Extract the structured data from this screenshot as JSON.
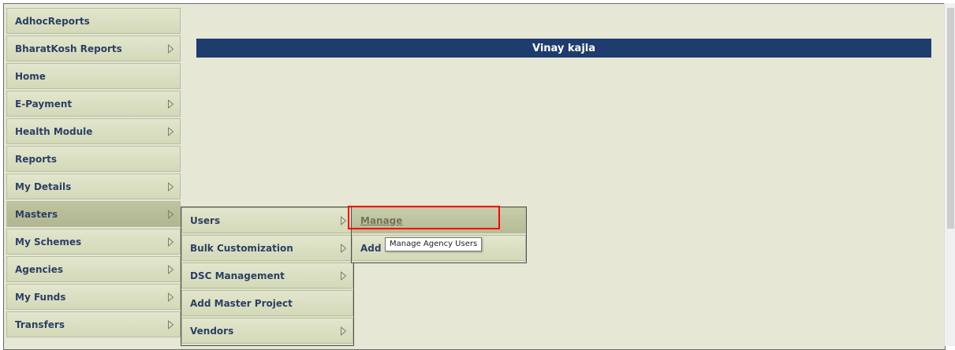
{
  "banner": {
    "user_name": "Vinay kajla"
  },
  "main_menu": [
    {
      "label": "AdhocReports",
      "has_arrow": false
    },
    {
      "label": "BharatKosh Reports",
      "has_arrow": true
    },
    {
      "label": "Home",
      "has_arrow": false
    },
    {
      "label": "E-Payment",
      "has_arrow": true
    },
    {
      "label": "Health Module",
      "has_arrow": true
    },
    {
      "label": "Reports",
      "has_arrow": false
    },
    {
      "label": "My Details",
      "has_arrow": true
    },
    {
      "label": "Masters",
      "has_arrow": true,
      "active": true
    },
    {
      "label": "My Schemes",
      "has_arrow": true
    },
    {
      "label": "Agencies",
      "has_arrow": true
    },
    {
      "label": "My Funds",
      "has_arrow": true
    },
    {
      "label": "Transfers",
      "has_arrow": true
    }
  ],
  "masters_submenu": [
    {
      "label": "Users",
      "has_arrow": true
    },
    {
      "label": "Bulk Customization",
      "has_arrow": true
    },
    {
      "label": "DSC Management",
      "has_arrow": true
    },
    {
      "label": "Add Master Project",
      "has_arrow": false
    },
    {
      "label": "Vendors",
      "has_arrow": true
    }
  ],
  "users_submenu": [
    {
      "label": "Manage"
    },
    {
      "label": "Add New"
    }
  ],
  "tooltip": {
    "text": "Manage Agency Users"
  },
  "colors": {
    "banner_bg": "#1f3c6e",
    "menu_text": "#2c3f63",
    "highlight": "#ff0000",
    "page_bg": "#e6e7d5"
  },
  "icons": {
    "submenu_arrow": "triangle-right-outline-icon"
  }
}
